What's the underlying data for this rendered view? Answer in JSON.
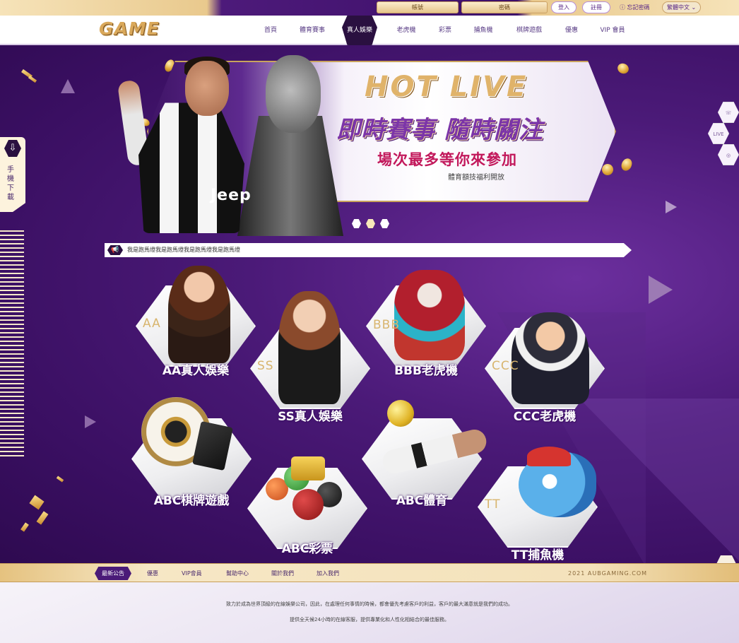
{
  "top": {
    "account_placeholder": "帳號",
    "password_placeholder": "密碼",
    "login_label": "登入",
    "register_label": "註冊",
    "forgot_label": "忘記密碼",
    "language_label": "繁體中文"
  },
  "nav": {
    "logo": "GAME",
    "items": [
      "首頁",
      "體育賽事",
      "真人娛樂",
      "老虎機",
      "彩票",
      "捕魚機",
      "棋牌遊戲",
      "優惠",
      "VIP 會員"
    ],
    "active_index": 2
  },
  "banner": {
    "headline_en": "HOT LIVE",
    "headline_cn": "即時賽事 隨時關注",
    "subline": "場次最多等你來參加",
    "note": "體育額技福利開放",
    "jersey_text": "Jeep",
    "slide_count": 3,
    "active_slide": 1
  },
  "marquee": {
    "text": "我是跑馬燈我是跑馬燈我是跑馬燈我是跑馬燈"
  },
  "side": {
    "mobile_download": "手機下載"
  },
  "games": [
    {
      "abbr": "AA",
      "label": "AA真人娛樂"
    },
    {
      "abbr": "SS",
      "label": "SS真人娛樂"
    },
    {
      "abbr": "BBB",
      "label": "BBB老虎機"
    },
    {
      "abbr": "CCC",
      "label": "CCC老虎機"
    },
    {
      "abbr": "",
      "label": "ABC棋牌遊戲"
    },
    {
      "abbr": "",
      "label": "ABC彩票"
    },
    {
      "abbr": "",
      "label": "ABC體育"
    },
    {
      "abbr": "TT",
      "label": "TT捕魚機"
    }
  ],
  "footer_nav": {
    "items": [
      "最新公告",
      "優惠",
      "VIP會員",
      "幫助中心",
      "關於我們",
      "加入我們"
    ],
    "copyright": "2021 AUBGAMING.COM"
  },
  "footer": {
    "line1": "致力於成為世界頂級的在線娛樂公司，因此，在處理任何事情的時候，都會優先考慮客戶的利益，客戶的最大滿意就是我們的成功。",
    "line2": "提供全天候24小時的在線客服，提供專業化和人性化相結合的最佳服務。"
  },
  "colors": {
    "brand_purple": "#3a0f62",
    "accent_gold": "#d9a85a",
    "headline_magenta": "#c2185b"
  }
}
